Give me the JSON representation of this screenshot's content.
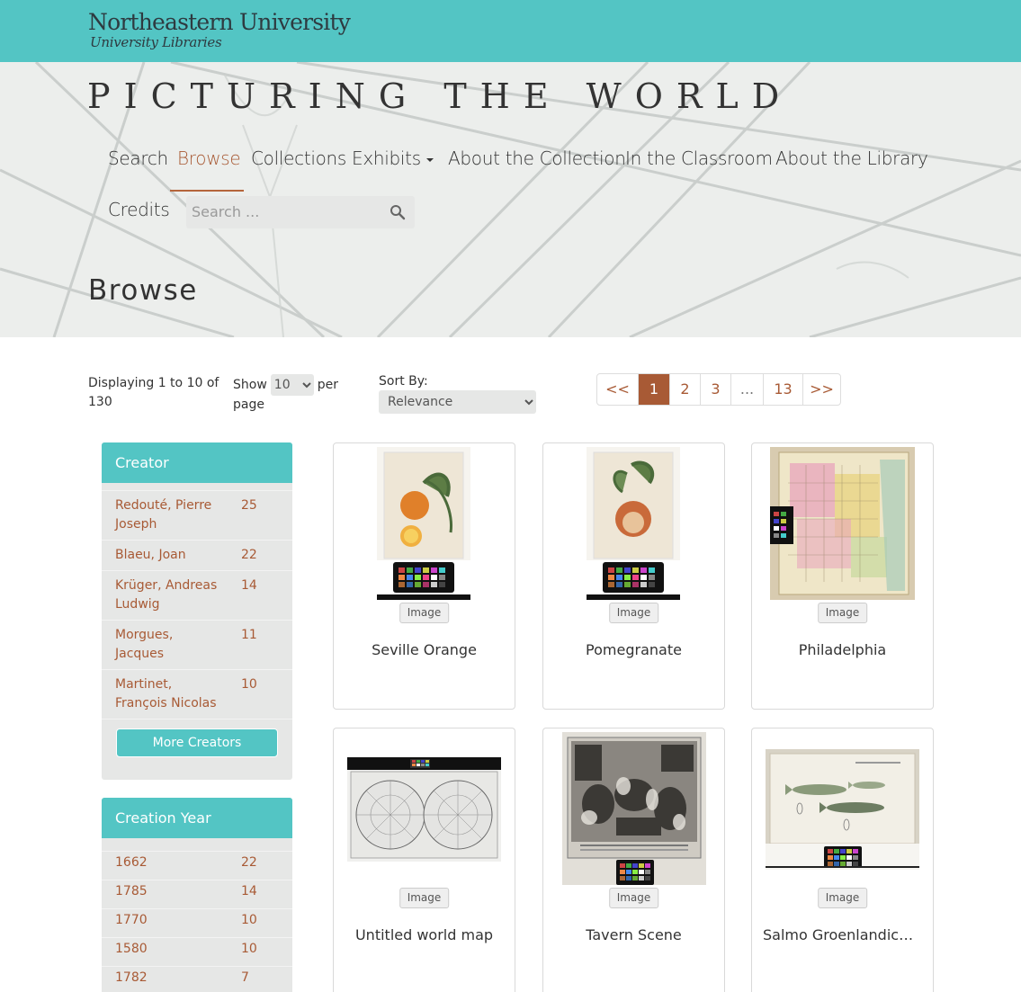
{
  "header": {
    "university": "Northeastern University",
    "libraries": "University Libraries"
  },
  "site": {
    "title": "PICTURING THE WORLD"
  },
  "nav": {
    "items": [
      {
        "label": "Search"
      },
      {
        "label": "Browse"
      },
      {
        "label": "Collections"
      },
      {
        "label": "Exhibits"
      },
      {
        "label": "About the Collection"
      },
      {
        "label": "In the Classroom"
      },
      {
        "label": "About the Library"
      },
      {
        "label": "Credits"
      }
    ],
    "search_placeholder": "Search ..."
  },
  "page": {
    "title": "Browse"
  },
  "controls": {
    "displaying": "Displaying 1 to 10 of 130",
    "show_label": "Show",
    "per_page_value": "10",
    "per_page_label": "per page",
    "sort_label": "Sort By:",
    "sort_value": "Relevance"
  },
  "pagination": [
    "<<",
    "1",
    "2",
    "3",
    "...",
    "13",
    ">>"
  ],
  "facets": {
    "creator": {
      "title": "Creator",
      "items": [
        {
          "label": "Redouté, Pierre Joseph",
          "count": "25"
        },
        {
          "label": "Blaeu, Joan",
          "count": "22"
        },
        {
          "label": "Krüger, Andreas Ludwig",
          "count": "14"
        },
        {
          "label": "Morgues, Jacques",
          "count": "11"
        },
        {
          "label": "Martinet, François Nicolas",
          "count": "10"
        }
      ],
      "more_label": "More Creators"
    },
    "year": {
      "title": "Creation Year",
      "items": [
        {
          "label": "1662",
          "count": "22"
        },
        {
          "label": "1785",
          "count": "14"
        },
        {
          "label": "1770",
          "count": "10"
        },
        {
          "label": "1580",
          "count": "10"
        },
        {
          "label": "1782",
          "count": "7"
        }
      ]
    }
  },
  "results": [
    {
      "title": "Seville Orange",
      "type": "Image"
    },
    {
      "title": "Pomegranate",
      "type": "Image"
    },
    {
      "title": "Philadelphia",
      "type": "Image"
    },
    {
      "title": "Untitled world map",
      "type": "Image"
    },
    {
      "title": "Tavern Scene",
      "type": "Image"
    },
    {
      "title": "Salmo Groenlandicus; ...",
      "type": "Image"
    }
  ]
}
